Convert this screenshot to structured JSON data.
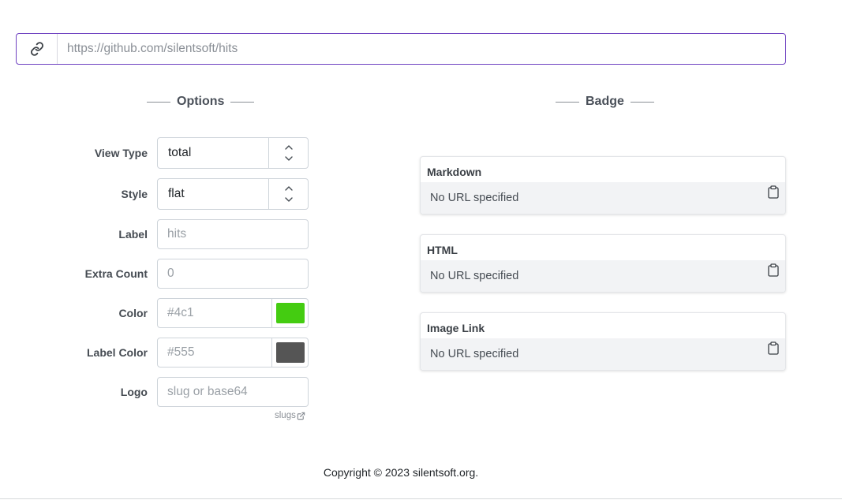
{
  "url_bar": {
    "icon": "link-icon",
    "placeholder": "https://github.com/silentsoft/hits"
  },
  "options": {
    "title": "Options",
    "view_type": {
      "label": "View Type",
      "value": "total"
    },
    "style": {
      "label": "Style",
      "value": "flat"
    },
    "label_field": {
      "label": "Label",
      "placeholder": "hits"
    },
    "extra_count": {
      "label": "Extra Count",
      "placeholder": "0"
    },
    "color": {
      "label": "Color",
      "placeholder": "#4c1",
      "swatch": "#44cc11"
    },
    "label_color": {
      "label": "Label Color",
      "placeholder": "#555",
      "swatch": "#555555"
    },
    "logo": {
      "label": "Logo",
      "placeholder": "slug or base64",
      "link_text": "slugs",
      "link_icon": "external-link-icon"
    }
  },
  "badge": {
    "title": "Badge",
    "cards": [
      {
        "title": "Markdown",
        "value": "No URL specified",
        "icon": "clipboard-icon"
      },
      {
        "title": "HTML",
        "value": "No URL specified",
        "icon": "clipboard-icon"
      },
      {
        "title": "Image Link",
        "value": "No URL specified",
        "icon": "clipboard-icon"
      }
    ]
  },
  "footer": {
    "text": "Copyright © 2023 silentsoft.org."
  },
  "colors": {
    "accent": "#6f42c1"
  }
}
